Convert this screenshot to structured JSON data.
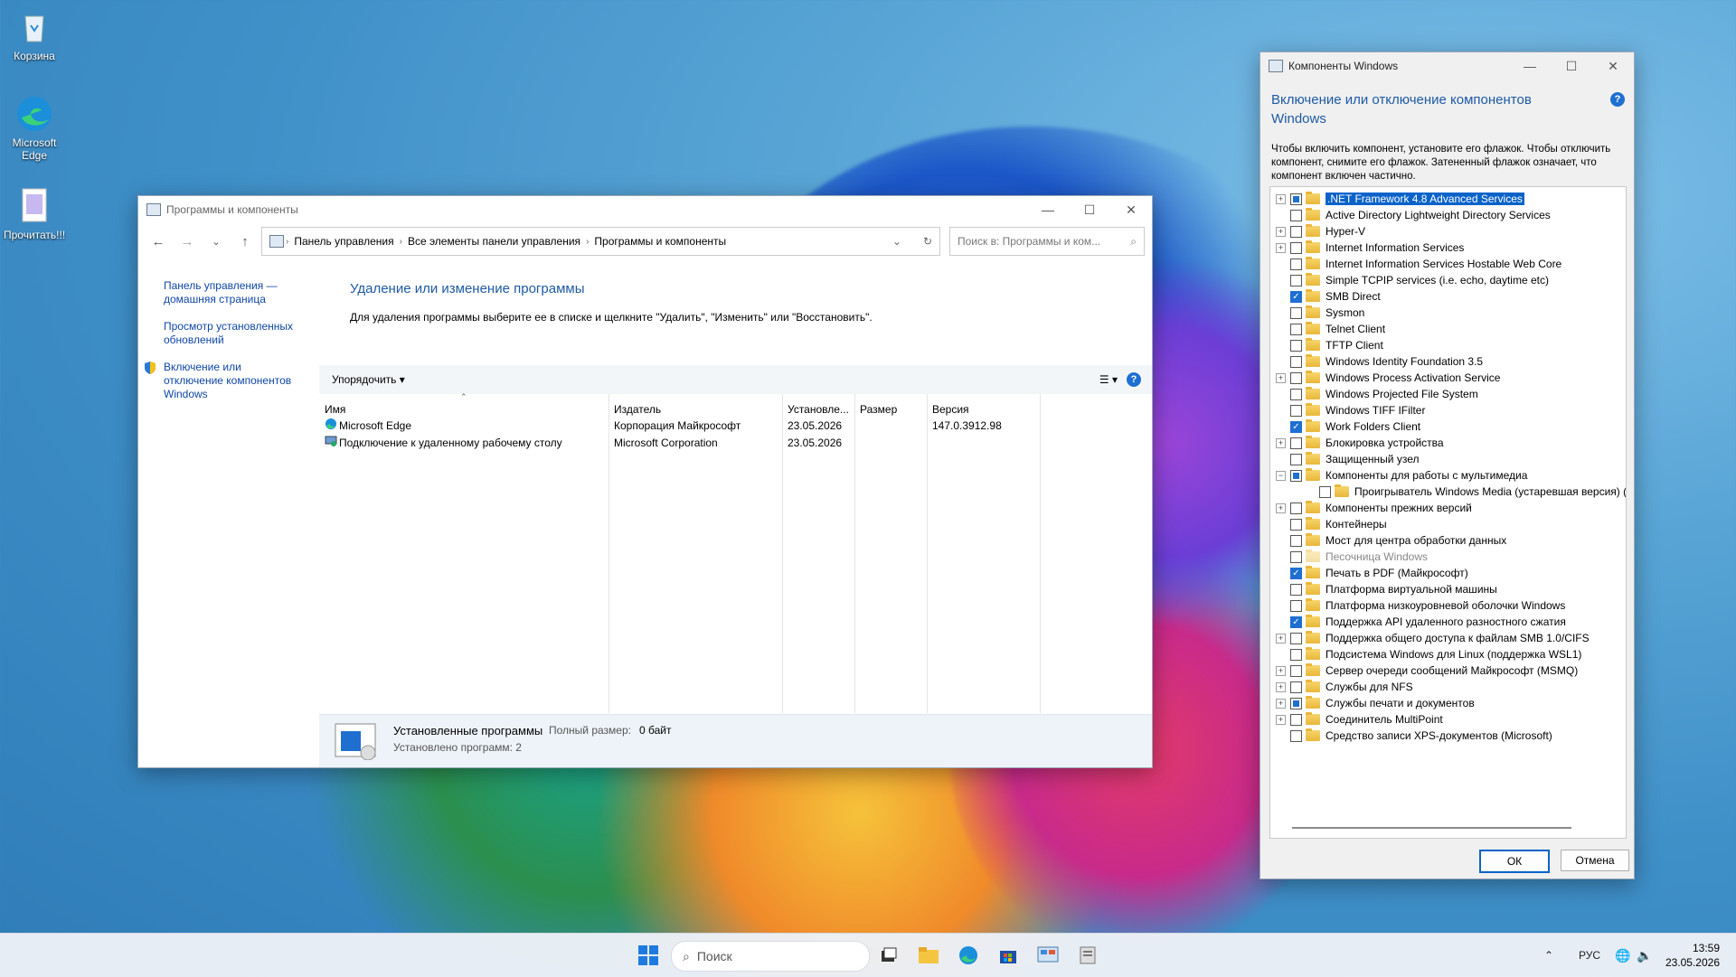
{
  "desktop": {
    "icons": [
      {
        "label": "Корзина"
      },
      {
        "label": "Microsoft Edge"
      },
      {
        "label": "Прочитать!!!"
      }
    ]
  },
  "programs_window": {
    "title": "Программы и компоненты",
    "breadcrumb": [
      "Панель управления",
      "Все элементы панели управления",
      "Программы и компоненты"
    ],
    "search_placeholder": "Поиск в: Программы и ком...",
    "sidebar": [
      "Панель управления — домашняя страница",
      "Просмотр установленных обновлений",
      "Включение или отключение компонентов Windows"
    ],
    "heading": "Удаление или изменение программы",
    "description": "Для удаления программы выберите ее в списке и щелкните \"Удалить\", \"Изменить\" или \"Восстановить\".",
    "organize_label": "Упорядочить",
    "columns": [
      "Имя",
      "Издатель",
      "Установле...",
      "Размер",
      "Версия"
    ],
    "rows": [
      {
        "name": "Microsoft Edge",
        "publisher": "Корпорация Майкрософт",
        "installed": "23.05.2026",
        "size": "",
        "version": "147.0.3912.98"
      },
      {
        "name": "Подключение к удаленному рабочему столу",
        "publisher": "Microsoft Corporation",
        "installed": "23.05.2026",
        "size": "",
        "version": ""
      }
    ],
    "status": {
      "label": "Установленные программы",
      "size_label": "Полный размер:",
      "size_value": "0 байт",
      "count": "Установлено программ: 2"
    }
  },
  "features_dialog": {
    "title": "Компоненты Windows",
    "heading": "Включение или отключение компонентов Windows",
    "description": "Чтобы включить компонент, установите его флажок. Чтобы отключить компонент, снимите его флажок. Затененный флажок означает, что компонент включен частично.",
    "items": [
      {
        "label": ".NET Framework 4.8 Advanced Services",
        "expandable": true,
        "state": "partial",
        "selected": true
      },
      {
        "label": "Active Directory Lightweight Directory Services",
        "expandable": false,
        "state": "off"
      },
      {
        "label": "Hyper-V",
        "expandable": true,
        "state": "off"
      },
      {
        "label": "Internet Information Services",
        "expandable": true,
        "state": "off"
      },
      {
        "label": "Internet Information Services Hostable Web Core",
        "expandable": false,
        "state": "off"
      },
      {
        "label": "Simple TCPIP services (i.e. echo, daytime etc)",
        "expandable": false,
        "state": "off"
      },
      {
        "label": "SMB Direct",
        "expandable": false,
        "state": "on"
      },
      {
        "label": "Sysmon",
        "expandable": false,
        "state": "off"
      },
      {
        "label": "Telnet Client",
        "expandable": false,
        "state": "off"
      },
      {
        "label": "TFTP Client",
        "expandable": false,
        "state": "off"
      },
      {
        "label": "Windows Identity Foundation 3.5",
        "expandable": false,
        "state": "off"
      },
      {
        "label": "Windows Process Activation Service",
        "expandable": true,
        "state": "off"
      },
      {
        "label": "Windows Projected File System",
        "expandable": false,
        "state": "off"
      },
      {
        "label": "Windows TIFF IFilter",
        "expandable": false,
        "state": "off"
      },
      {
        "label": "Work Folders Client",
        "expandable": false,
        "state": "on"
      },
      {
        "label": "Блокировка устройства",
        "expandable": true,
        "state": "off"
      },
      {
        "label": "Защищенный узел",
        "expandable": false,
        "state": "off"
      },
      {
        "label": "Компоненты для работы с мультимедиа",
        "expandable": "open",
        "state": "partial"
      },
      {
        "label": "Проигрыватель Windows Media (устаревшая версия) (при",
        "expandable": false,
        "state": "off",
        "child": true
      },
      {
        "label": "Компоненты прежних версий",
        "expandable": true,
        "state": "off"
      },
      {
        "label": "Контейнеры",
        "expandable": false,
        "state": "off"
      },
      {
        "label": "Мост для центра обработки данных",
        "expandable": false,
        "state": "off"
      },
      {
        "label": "Песочница Windows",
        "expandable": false,
        "state": "off",
        "disabled": true
      },
      {
        "label": "Печать в PDF (Майкрософт)",
        "expandable": false,
        "state": "on"
      },
      {
        "label": "Платформа виртуальной машины",
        "expandable": false,
        "state": "off"
      },
      {
        "label": "Платформа низкоуровневой оболочки Windows",
        "expandable": false,
        "state": "off"
      },
      {
        "label": "Поддержка API удаленного разностного сжатия",
        "expandable": false,
        "state": "on"
      },
      {
        "label": "Поддержка общего доступа к файлам SMB 1.0/CIFS",
        "expandable": true,
        "state": "off"
      },
      {
        "label": "Подсистема Windows для Linux (поддержка WSL1)",
        "expandable": false,
        "state": "off"
      },
      {
        "label": "Сервер очереди сообщений Майкрософт (MSMQ)",
        "expandable": true,
        "state": "off"
      },
      {
        "label": "Службы для NFS",
        "expandable": true,
        "state": "off"
      },
      {
        "label": "Службы печати и документов",
        "expandable": true,
        "state": "partial"
      },
      {
        "label": "Соединитель MultiPoint",
        "expandable": true,
        "state": "off"
      },
      {
        "label": "Средство записи XPS-документов (Microsoft)",
        "expandable": false,
        "state": "off"
      }
    ],
    "ok_label": "ОК",
    "cancel_label": "Отмена"
  },
  "taskbar": {
    "search_label": "Поиск",
    "lang": "РУС",
    "time": "13:59",
    "date": "23.05.2026"
  }
}
